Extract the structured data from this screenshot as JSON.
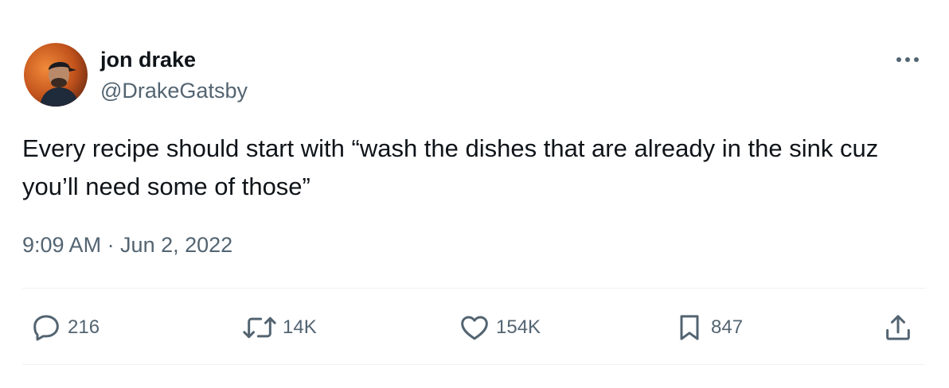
{
  "author": {
    "display_name": "jon drake",
    "handle": "@DrakeGatsby"
  },
  "tweet": {
    "text": "Every recipe should start with “wash the dishes that are already in the sink cuz you’ll need some of those”",
    "timestamp": "9:09 AM · Jun 2, 2022"
  },
  "actions": {
    "replies": "216",
    "reposts": "14K",
    "likes": "154K",
    "bookmarks": "847"
  },
  "icons": {
    "more": "more-dots-icon",
    "reply": "reply-bubble-icon",
    "repost": "repost-arrows-icon",
    "like": "heart-icon",
    "bookmark": "bookmark-icon",
    "share": "share-upload-icon"
  },
  "colors": {
    "text_primary": "#0f1419",
    "text_secondary": "#536471",
    "divider": "#eff3f4"
  }
}
